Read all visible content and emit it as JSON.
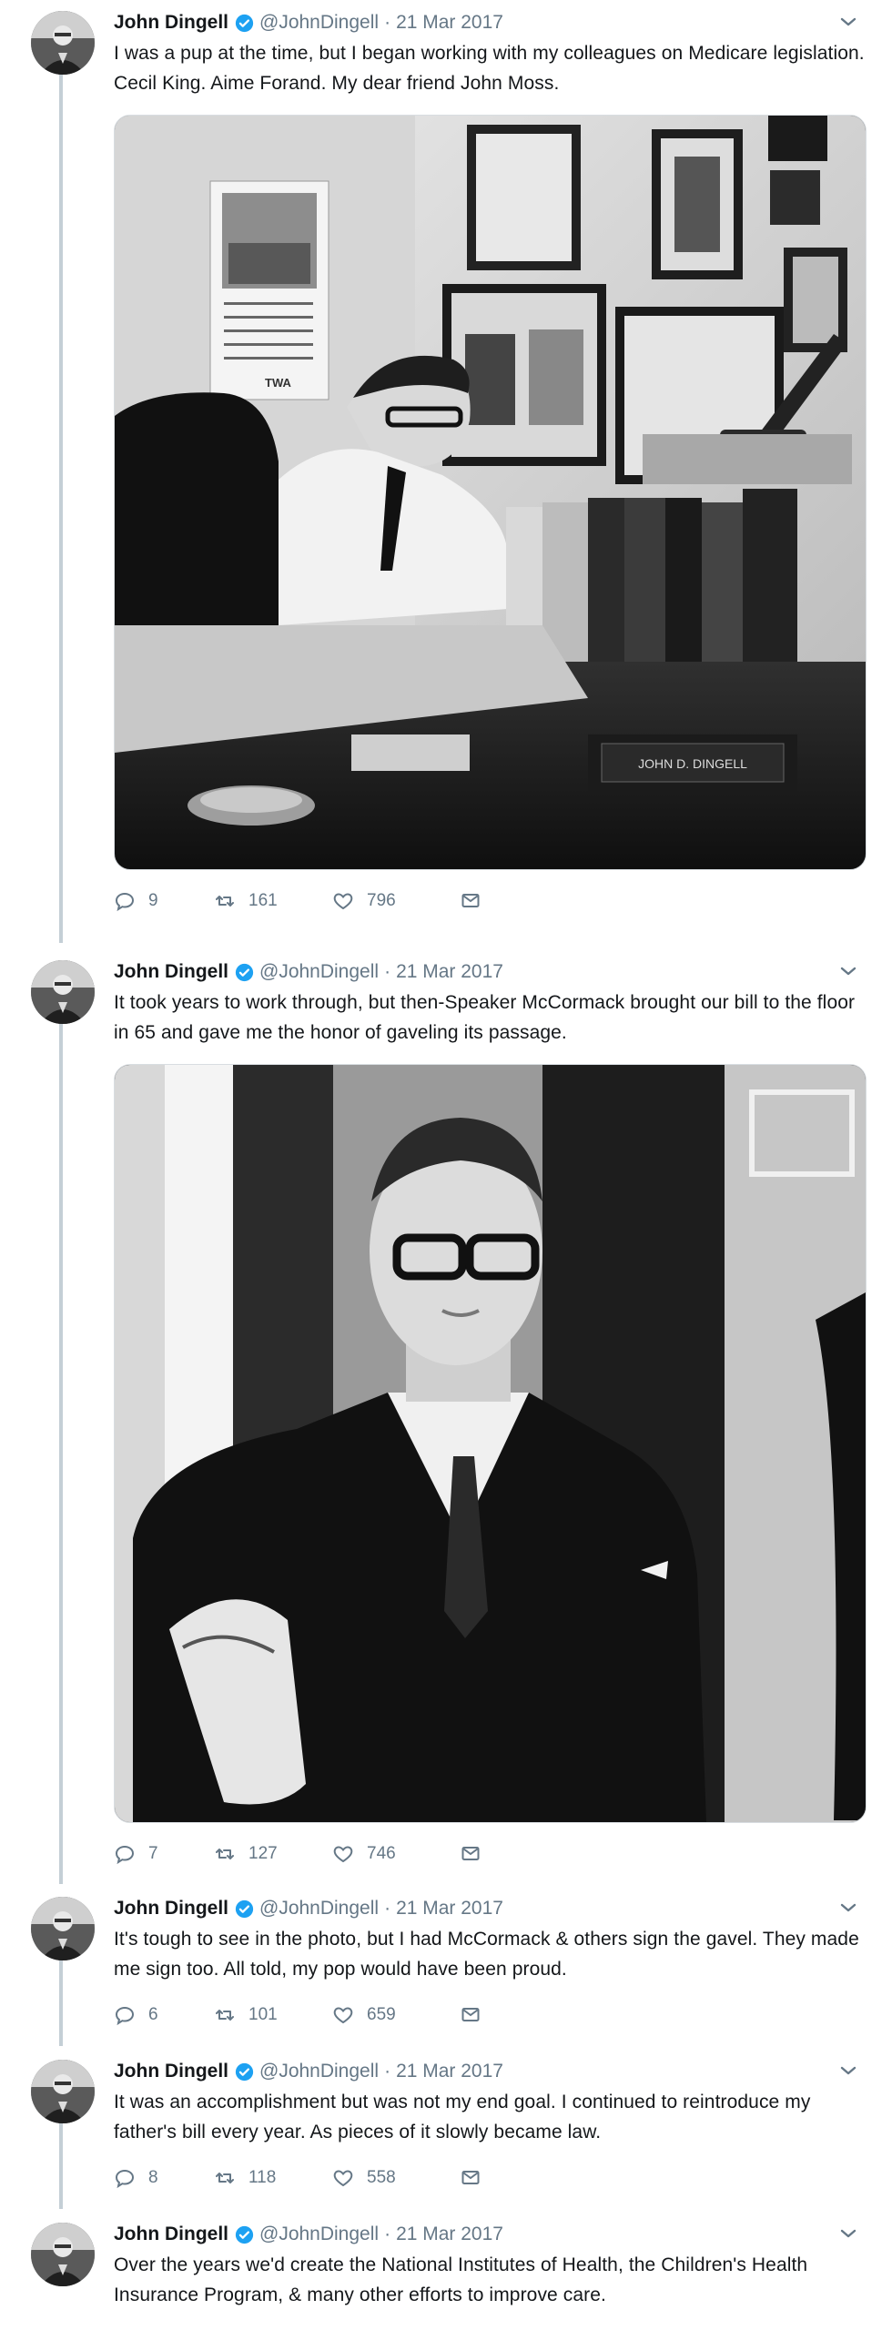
{
  "thread": [
    {
      "name": "John Dingell",
      "handle": "@JohnDingell",
      "date": "21 Mar 2017",
      "text": "I was a pup at the time, but I began working with my colleagues on Medicare legislation. Cecil King. Aime Forand. My dear friend John Moss.",
      "reply_count": "9",
      "retweet_count": "161",
      "like_count": "796",
      "media": {
        "desk_nameplate": "JOHN D. DINGELL",
        "calendar_logo": "TWA"
      }
    },
    {
      "name": "John Dingell",
      "handle": "@JohnDingell",
      "date": "21 Mar 2017",
      "text": "It took years to work through, but then-Speaker McCormack brought our bill to the floor in 65 and gave me the honor of gaveling its passage.",
      "reply_count": "7",
      "retweet_count": "127",
      "like_count": "746"
    },
    {
      "name": "John Dingell",
      "handle": "@JohnDingell",
      "date": "21 Mar 2017",
      "text": "It's tough to see in the photo, but I had McCormack & others sign the gavel. They made me sign too. All told, my pop would have been proud.",
      "reply_count": "6",
      "retweet_count": "101",
      "like_count": "659"
    },
    {
      "name": "John Dingell",
      "handle": "@JohnDingell",
      "date": "21 Mar 2017",
      "text": "It was an accomplishment but was not my end goal. I continued to reintroduce my father's bill every year. As pieces of it slowly became law.",
      "reply_count": "8",
      "retweet_count": "118",
      "like_count": "558"
    },
    {
      "name": "John Dingell",
      "handle": "@JohnDingell",
      "date": "21 Mar 2017",
      "text": "Over the years we'd create the National Institutes of Health, the Children's Health Insurance Program, & many other efforts to improve care."
    }
  ],
  "colors": {
    "text": "#14171a",
    "secondary": "#657786",
    "thread_line": "#c4cfd6",
    "verified": "#1da1f2"
  }
}
